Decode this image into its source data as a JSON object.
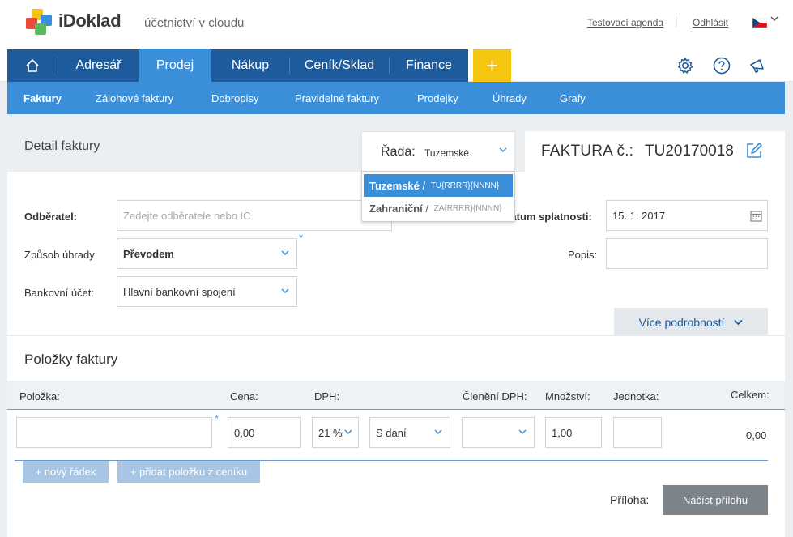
{
  "header": {
    "app_name": "iDoklad",
    "tagline": "účetnictví v cloudu",
    "agenda_link": "Testovací agenda",
    "separator": "|",
    "logout_link": "Odhlásit"
  },
  "main_nav": {
    "items": [
      {
        "label": "Adresář"
      },
      {
        "label": "Prodej"
      },
      {
        "label": "Nákup"
      },
      {
        "label": "Ceník/Sklad"
      },
      {
        "label": "Finance"
      }
    ],
    "plus": "+"
  },
  "sub_nav": {
    "items": [
      {
        "label": "Faktury"
      },
      {
        "label": "Zálohové faktury"
      },
      {
        "label": "Dobropisy"
      },
      {
        "label": "Pravidelné faktury"
      },
      {
        "label": "Prodejky"
      },
      {
        "label": "Úhrady"
      },
      {
        "label": "Grafy"
      }
    ]
  },
  "detail": {
    "title": "Detail faktury",
    "rada_label": "Řada:",
    "rada_value": "Tuzemské",
    "invoice_title": "FAKTURA č.:",
    "invoice_number": "TU20170018"
  },
  "dropdown": {
    "options": [
      {
        "name": "Tuzemské",
        "sep": " / ",
        "pattern": "TU{RRRR}{NNNN}"
      },
      {
        "name": "Zahraniční",
        "sep": " / ",
        "pattern": "ZA{RRRR}{NNNN}"
      }
    ]
  },
  "form": {
    "odberatel_label": "Odběratel:",
    "odberatel_placeholder": "Zadejte odběratele nebo IČ",
    "zpusob_label": "Způsob úhrady:",
    "zpusob_value": "Převodem",
    "ucet_label": "Bankovní účet:",
    "ucet_value": "Hlavní bankovní spojení",
    "splatnost_label": "Datum splatnosti:",
    "splatnost_value": "15. 1. 2017",
    "popis_label": "Popis:",
    "popis_value": "",
    "more_label": "Více podrobností",
    "required": "*"
  },
  "items": {
    "title": "Položky faktury",
    "columns": {
      "polozka": "Položka:",
      "cena": "Cena:",
      "dph": "DPH:",
      "cleneni": "Členění DPH:",
      "mnozstvi": "Množství:",
      "jednotka": "Jednotka:",
      "celkem": "Celkem:"
    },
    "row": {
      "polozka": "",
      "cena": "0,00",
      "dph": "21 %",
      "typ": "S daní",
      "cleneni": "",
      "mnozstvi": "1,00",
      "jednotka": "",
      "celkem": "0,00"
    },
    "add_row": "+ nový řádek",
    "add_from_pricelist": "+ přidat položku z ceníku",
    "attachment_label": "Příloha:",
    "attachment_button": "Načíst přílohu"
  },
  "colors": {
    "nav_dark": "#1e5b9c",
    "nav_active": "#3b8fd9",
    "plus_yellow": "#f6c50f",
    "button_gray": "#7c8389"
  }
}
